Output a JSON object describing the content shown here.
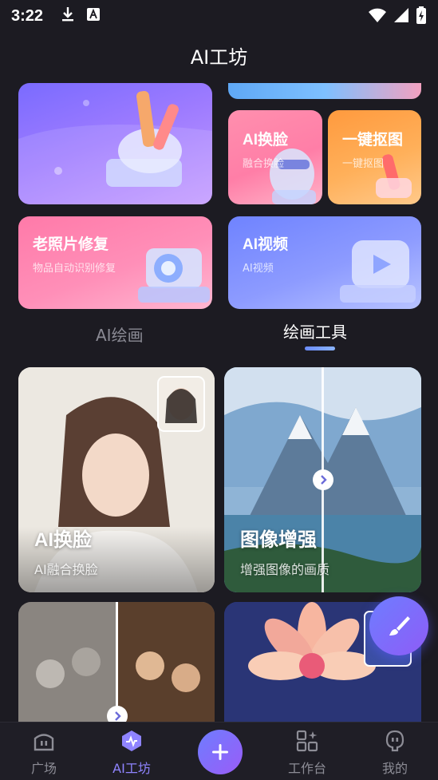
{
  "status": {
    "time": "3:22"
  },
  "header": {
    "title": "AI工坊"
  },
  "feature_cards": [
    {
      "title": "AI换脸",
      "subtitle": "融合换脸"
    },
    {
      "title": "一键抠图",
      "subtitle": "一键抠图"
    },
    {
      "title": "老照片修复",
      "subtitle": "物品自动识别修复"
    },
    {
      "title": "AI视频",
      "subtitle": "AI视频"
    }
  ],
  "tabs": [
    {
      "label": "AI绘画",
      "active": false
    },
    {
      "label": "绘画工具",
      "active": true
    }
  ],
  "tiles": [
    {
      "title": "AI换脸",
      "subtitle": "AI融合换脸"
    },
    {
      "title": "图像增强",
      "subtitle": "增强图像的画质"
    }
  ],
  "bottom_nav": [
    {
      "label": "广场",
      "icon": "plaza-icon",
      "active": false
    },
    {
      "label": "AI工坊",
      "icon": "ai-workshop-icon",
      "active": true
    },
    {
      "label": "",
      "icon": "plus-icon",
      "active": false
    },
    {
      "label": "工作台",
      "icon": "workbench-icon",
      "active": false
    },
    {
      "label": "我的",
      "icon": "profile-icon",
      "active": false
    }
  ],
  "colors": {
    "background": "#1c1b22",
    "accent": "#8f84ff"
  }
}
